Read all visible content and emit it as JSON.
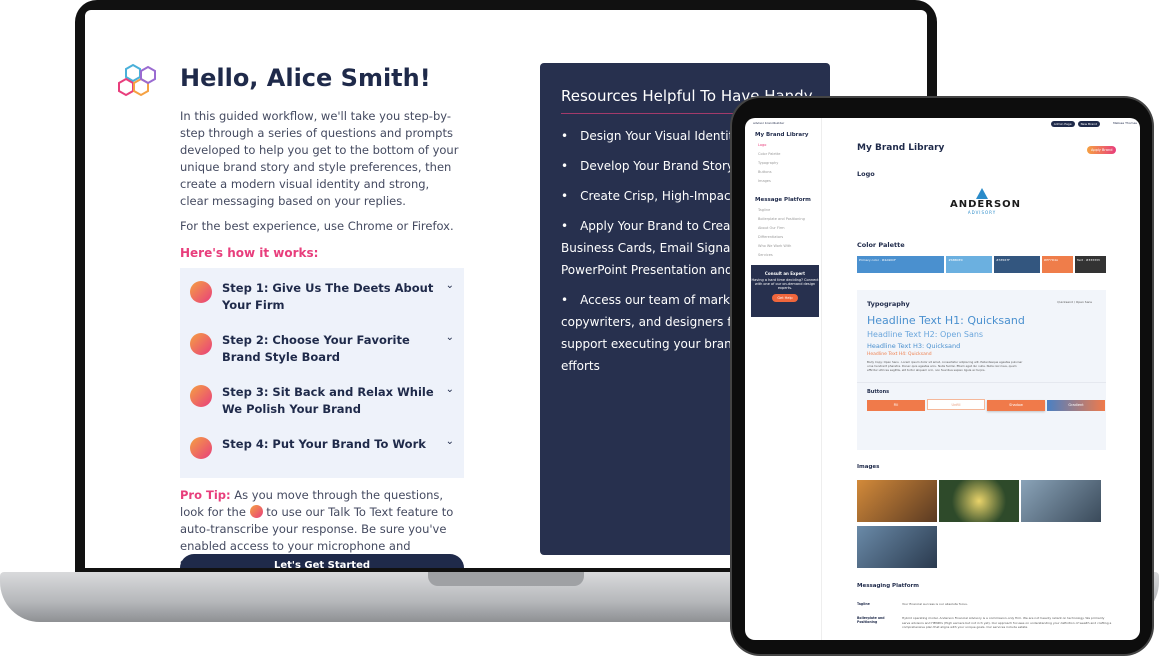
{
  "laptop": {
    "greeting": "Hello, Alice Smith!",
    "intro": "In this guided workflow, we'll take you step-by-step through a series of questions and prompts developed to help you get to the bottom of your unique brand story and style preferences, then create a modern visual identity and strong, clear messaging based on your replies.",
    "browser_note": "For the best experience, use Chrome or Firefox.",
    "how_it_works": "Here's how it works:",
    "steps": [
      {
        "label": "Step 1: Give Us The Deets About Your Firm",
        "icon": "list-icon"
      },
      {
        "label": "Step 2: Choose Your Favorite Brand Style Board",
        "icon": "cursor-board-icon"
      },
      {
        "label": "Step 3: Sit Back and Relax While We Polish Your Brand",
        "icon": "person-icon"
      },
      {
        "label": "Step 4: Put Your Brand To Work",
        "icon": "thumbs-up-icon"
      }
    ],
    "pro_tip_label": "Pro Tip:",
    "pro_tip_1": " As you move through the questions, look for the ",
    "pro_tip_2": " to use our Talk To Text feature to auto-transcribe your response. Be sure you've enabled access to your microphone and speakers in your device settings.",
    "start_button": "Let's Get Started",
    "resources": {
      "title": "Resources Helpful To Have Handy",
      "items": [
        "Design Your Visual Identity",
        "Develop Your Brand Story",
        "Create Crisp, High-Impact M",
        "Apply Your Brand to Create",
        "Business Cards, Email Signature",
        "PowerPoint Presentation and mo",
        "Access our team of marketin",
        "copywriters, and designers for a",
        "support executing your brand ar",
        "efforts"
      ]
    }
  },
  "tablet": {
    "logo_text": "advisor brandbuilder",
    "header_buttons": [
      "Admin Page",
      "New Brand"
    ],
    "user_name": "Melissa Thomas",
    "sidebar": {
      "brand_title": "My Brand Library",
      "brand_items": [
        "Logo",
        "Color Palette",
        "Typography",
        "Buttons",
        "Images"
      ],
      "message_title": "Message Platform",
      "message_items": [
        "Tagline",
        "Boilerplate and Positioning",
        "About Our Firm",
        "Differentiators",
        "Who We Work With",
        "Services"
      ],
      "expert": {
        "title": "Consult an Expert",
        "text": "Having a hard time deciding? Connect with one of our on-demand design experts.",
        "button": "Get Help"
      }
    },
    "title": "My Brand Library",
    "apply_button": "Apply Brand",
    "logo_section": "Logo",
    "brand_logo": {
      "name": "ANDERSON",
      "sub": "ADVISORY"
    },
    "palette_section": "Color Palette",
    "palette": [
      {
        "label": "Primary color · #4A90CF",
        "color": "#4a90cf"
      },
      {
        "label": "#6BB0E0",
        "color": "#6bb0e0"
      },
      {
        "label": "#33567F",
        "color": "#33567f"
      },
      {
        "label": "#EF7D4A",
        "color": "#ef7d4a"
      },
      {
        "label": "Text · #333333",
        "color": "#333333"
      }
    ],
    "typography_section": "Typography",
    "fonts": "Quicksand / Open Sans",
    "h1": "Headline Text H1: Quicksand",
    "h2": "Headline Text H2: Open Sans",
    "h3": "Headline Text H3: Quicksand",
    "h4": "Headline Text H4: Quicksand",
    "body": "Body Copy: Open Sans · Lorem ipsum dolor sit amet, consectetur adipiscing elit. Pellentesque egestas pulvinar urna hendrerit pharetra. Donec quis egestas arcu. Nulla facilisi. Etiam eget dui nulla. Nulla nisl risus, quam efficitur ultrices sagittis, elit tortor aliquam orci, non faucibus sapien ligula ac turpis.",
    "buttons_section": "Buttons",
    "buttons": [
      "Fill",
      "Unfill",
      "Shadow",
      "Gradient"
    ],
    "images_section": "Images",
    "messaging_section": "Messaging Platform",
    "tagline_label": "Tagline",
    "tagline": "Your financial success is our absolute focus.",
    "boilerplate_label": "Boilerplate and Positioning",
    "boilerplate": "Hybrid operating model. Anderson Financial Advisory is a commission-only firm. We are not heavily reliant on technology. We primarily serve advisors and HENRYs (High earners but not rich yet). Our approach focuses on understanding your definition of wealth and crafting a comprehensive plan that aligns with your unique goals. Our services include estate"
  },
  "colors": {
    "navy": "#1f2a4a",
    "pink": "#e83e7c",
    "orange": "#f07a4a",
    "blue": "#4a90cf"
  }
}
